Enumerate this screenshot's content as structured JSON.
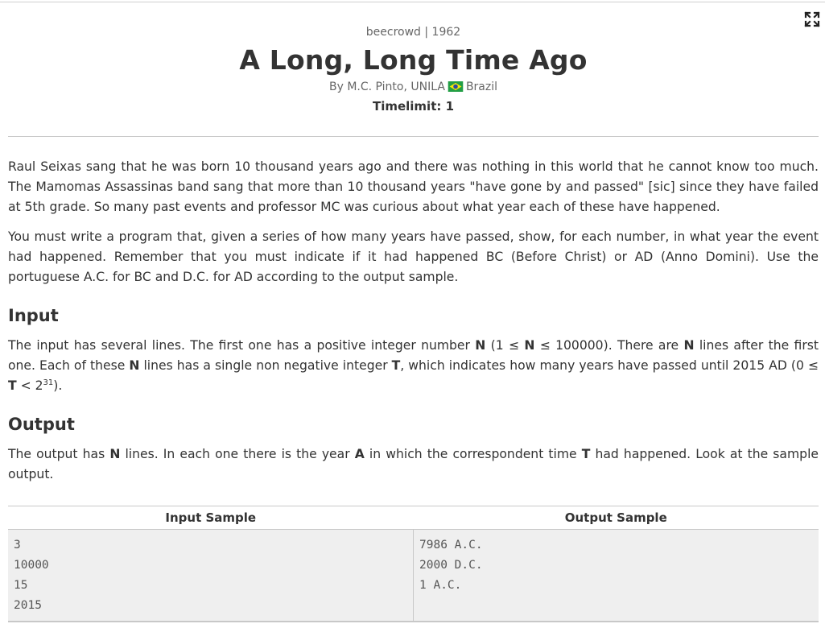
{
  "header": {
    "source": "beecrowd | 1962",
    "title": "A Long, Long Time Ago",
    "author_prefix": "By M.C. Pinto, UNILA",
    "author_country": "Brazil",
    "timelimit": "Timelimit: 1"
  },
  "statement": {
    "p1": "Raul Seixas sang that he was born 10 thousand years ago and there was nothing in this world that he cannot know too much. The Mamomas Assassinas band sang that more than 10 thousand years \"have gone by and passed\" [sic] since they have failed at 5th grade. So many past events and professor MC was curious about what year each of these have happened.",
    "p2": "You must write a program that, given a series of how many years have passed, show, for each number, in what year the event had happened. Remember that you must indicate if it had happened BC (Before Christ) or AD (Anno Domini). Use the portuguese A.C. for BC and D.C. for AD according to the output sample."
  },
  "input_section": {
    "heading": "Input",
    "t1": "The input has several lines. The first one has a positive integer number ",
    "b1": "N",
    "t2": " (1 ≤ ",
    "b2": "N",
    "t3": " ≤ 100000). There are ",
    "b3": "N",
    "t4": " lines after the first one. Each of these ",
    "b4": "N",
    "t5": " lines has a single non negative integer ",
    "b5": "T",
    "t6": ", which indicates how many years have passed until 2015 AD (0 ≤ ",
    "b6": "T",
    "t7": " < 2",
    "sup": "31",
    "t8": ")."
  },
  "output_section": {
    "heading": "Output",
    "t1": "The output has ",
    "b1": "N",
    "t2": " lines. In each one there is the year ",
    "b2": "A",
    "t3": " in which the correspondent time ",
    "b3": "T",
    "t4": " had happened. Look at the sample output."
  },
  "samples": {
    "input_label": "Input Sample",
    "output_label": "Output Sample",
    "input_lines": [
      "3",
      "10000",
      "15",
      "2015"
    ],
    "output_lines": [
      "7986 A.C.",
      "2000 D.C.",
      "1 A.C."
    ]
  },
  "colors": {
    "flag_green": "#229e45",
    "flag_yellow": "#f8e509",
    "flag_blue": "#2b49a3"
  },
  "icons": {
    "fullscreen": "expand-icon",
    "flag": "brazil-flag-icon"
  }
}
